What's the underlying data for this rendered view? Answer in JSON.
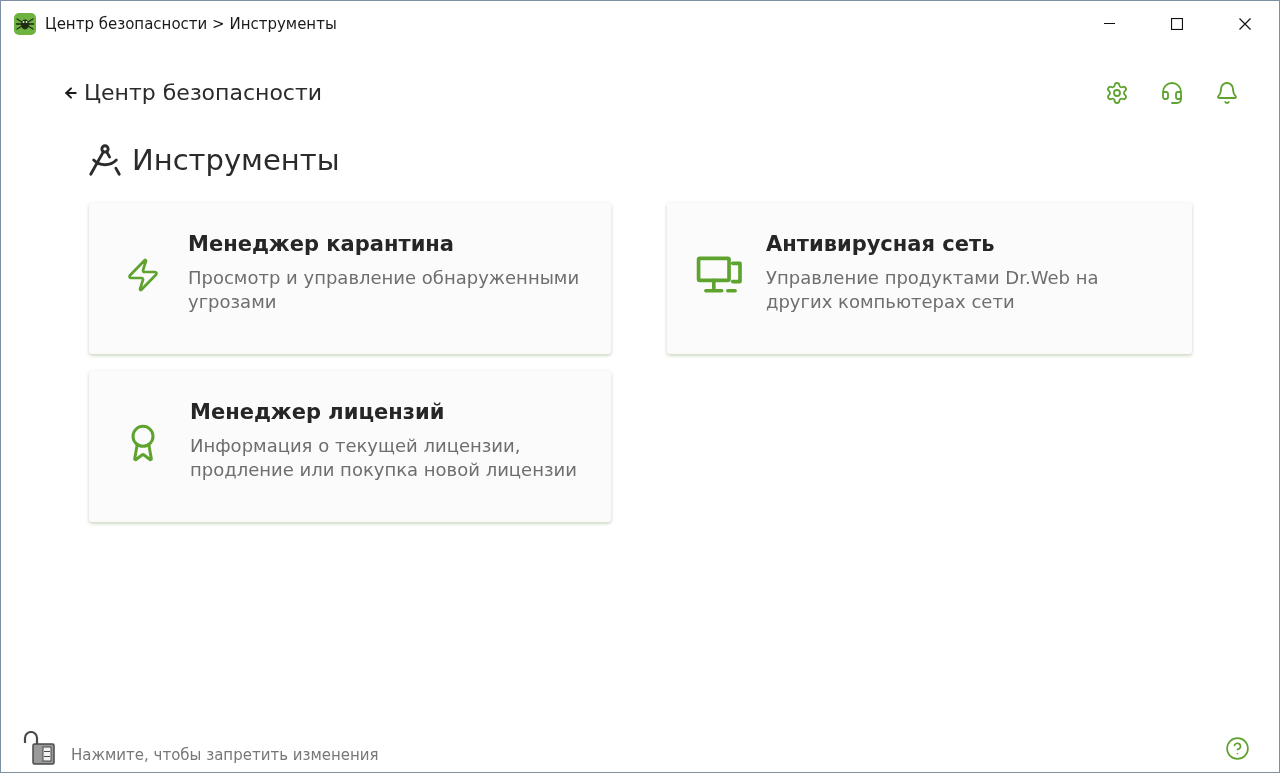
{
  "window": {
    "title": "Центр безопасности > Инструменты"
  },
  "header": {
    "back_link": "Центр безопасности"
  },
  "section": {
    "title": "Инструменты"
  },
  "tools": [
    {
      "kind": "quarantine",
      "title": "Менеджер карантина",
      "description": "Просмотр и управление обнаруженными угрозами"
    },
    {
      "kind": "network",
      "title": "Антивирусная сеть",
      "description": "Управление продуктами Dr.Web на других компьютерах сети"
    },
    {
      "kind": "license",
      "title": "Менеджер лицензий",
      "description": "Информация о текущей лицензии, продление или покупка новой лицензии"
    }
  ],
  "footer": {
    "lock_hint": "Нажмите, чтобы запретить изменения"
  }
}
